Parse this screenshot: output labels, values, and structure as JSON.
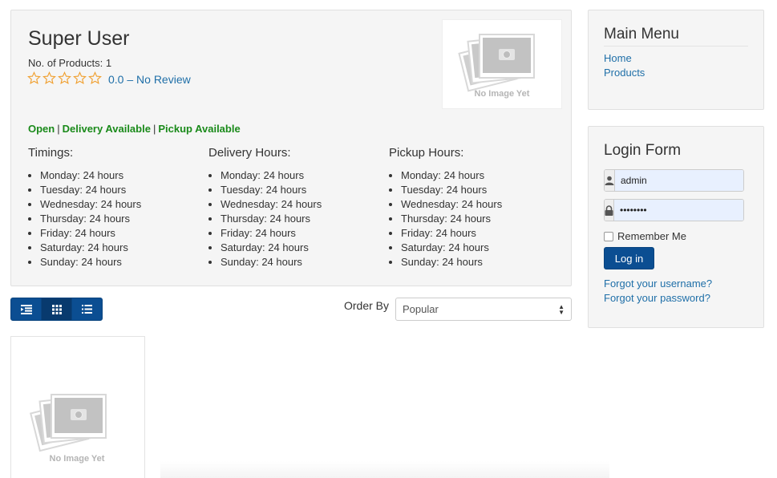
{
  "vendor": {
    "name": "Super User",
    "product_count": "No. of Products: 1",
    "rating_text": "0.0 – No Review",
    "stars_filled": 0,
    "stars_total": 5,
    "image_caption": "No Image Yet",
    "status": {
      "open": "Open",
      "delivery": "Delivery Available",
      "pickup": "Pickup Available",
      "separator": "|"
    },
    "timings": {
      "title": "Timings:",
      "items": [
        "Monday: 24 hours",
        "Tuesday: 24 hours",
        "Wednesday: 24 hours",
        "Thursday: 24 hours",
        "Friday: 24 hours",
        "Saturday: 24 hours",
        "Sunday: 24 hours"
      ]
    },
    "delivery_hours": {
      "title": "Delivery Hours:",
      "items": [
        "Monday: 24 hours",
        "Tuesday: 24 hours",
        "Wednesday: 24 hours",
        "Thursday: 24 hours",
        "Friday: 24 hours",
        "Saturday: 24 hours",
        "Sunday: 24 hours"
      ]
    },
    "pickup_hours": {
      "title": "Pickup Hours:",
      "items": [
        "Monday: 24 hours",
        "Tuesday: 24 hours",
        "Wednesday: 24 hours",
        "Thursday: 24 hours",
        "Friday: 24 hours",
        "Saturday: 24 hours",
        "Sunday: 24 hours"
      ]
    }
  },
  "toolbar": {
    "view_icons": [
      "indent-list-icon",
      "grid-icon",
      "list-icon"
    ],
    "order_label": "Order By",
    "order_value": "Popular"
  },
  "products": [
    {
      "image_caption": "No Image Yet"
    }
  ],
  "main_menu": {
    "title": "Main Menu",
    "items": [
      "Home",
      "Products"
    ]
  },
  "login": {
    "title": "Login Form",
    "username_value": "admin",
    "password_value": "••••••••",
    "remember_label": "Remember Me",
    "login_label": "Log in",
    "forgot_username": "Forgot your username?",
    "forgot_password": "Forgot your password?"
  },
  "colors": {
    "link": "#1f6fa8",
    "status_green": "#1a8a1a",
    "primary_button": "#0b4e92",
    "star": "#f0a030"
  }
}
